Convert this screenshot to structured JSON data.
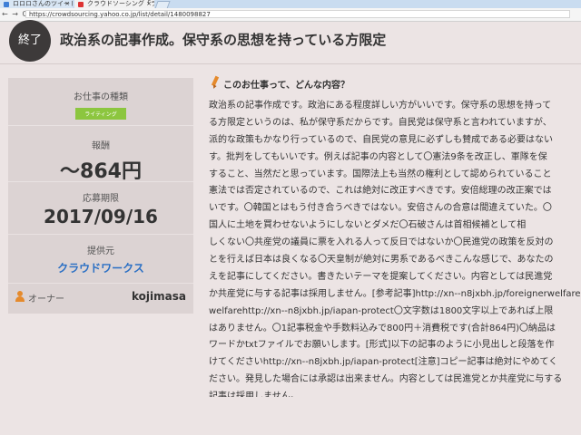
{
  "browser": {
    "tabs": [
      {
        "label": "ロロロさんのツイート"
      },
      {
        "label": "クラウドソーシング「ラ"
      }
    ],
    "tab_close": "×",
    "nav_icons": "← → C",
    "url": "https://crowdsourcing.yahoo.co.jp/list/detail/1480098827"
  },
  "header": {
    "status": "終了",
    "title": "政治系の記事作成。保守系の思想を持っている方限定"
  },
  "sidebar": {
    "job_type_label": "お仕事の種類",
    "job_type_tag": "ライティング",
    "reward_label": "報酬",
    "reward_value": "～864円",
    "deadline_label": "応募期限",
    "deadline_value": "2017/09/16",
    "client_label": "提供元",
    "client_name": "クラウドワークス",
    "owner_label": "オーナー",
    "owner_name": "kojimasa"
  },
  "content": {
    "section_title": "このお仕事って、どんな内容？",
    "lines": [
      "政治系の記事作成です。政治にある程度詳しい方がいいです。保守系の思想を持って",
      "る方限定というのは、私が保守系だからです。自民党は保守系と言われていますが、",
      "派的な政策もかなり行っているので、自民党の意見に必ずしも賛成である必要はない",
      "す。批判をしてもいいです。例えば記事の内容として〇憲法9条を改正し、軍隊を保",
      "すること、当然だと思っています。国際法上も当然の権利として認められていること",
      "憲法では否定されているので、これは絶対に改正すべきです。安倍総理の改正案では",
      "いです。〇韓国とはもう付き合うべきではない。安倍さんの合意は間違えていた。〇",
      "国人に土地を買わせないようにしないとダメだ〇石破さんは首相候補として相",
      "しくない〇共産党の議員に票を入れる人って反日ではないか〇民進党の政策を反対の",
      "とを行えば日本は良くなる〇天皇制が絶対に男系であるべきこんな感じで、あなたの",
      "えを記事にしてください。書きたいテーマを提案してください。内容としては民進党",
      "か共産党に与する記事は採用しません。[参考記事]http://xn--n8jxbh.jp/foreignerwelfare",
      "welfarehttp://xn--n8jxbh.jp/iapan-protect〇文字数は1800文字以上であれば上限",
      "はありません。〇1記事税金や手数料込みで800円＋消費税です(合計864円)〇納品は",
      "ワードかtxtファイルでお願いします。[形式]以下の記事のように小見出しと段落を作",
      "けてくださいhttp://xn--n8jxbh.jp/iapan-protect[注意]コピー記事は絶対にやめてく",
      "ださい。発見した場合には承認は出来ません。内容としては民進党とか共産党に与する",
      "記事は採用しません。"
    ]
  }
}
